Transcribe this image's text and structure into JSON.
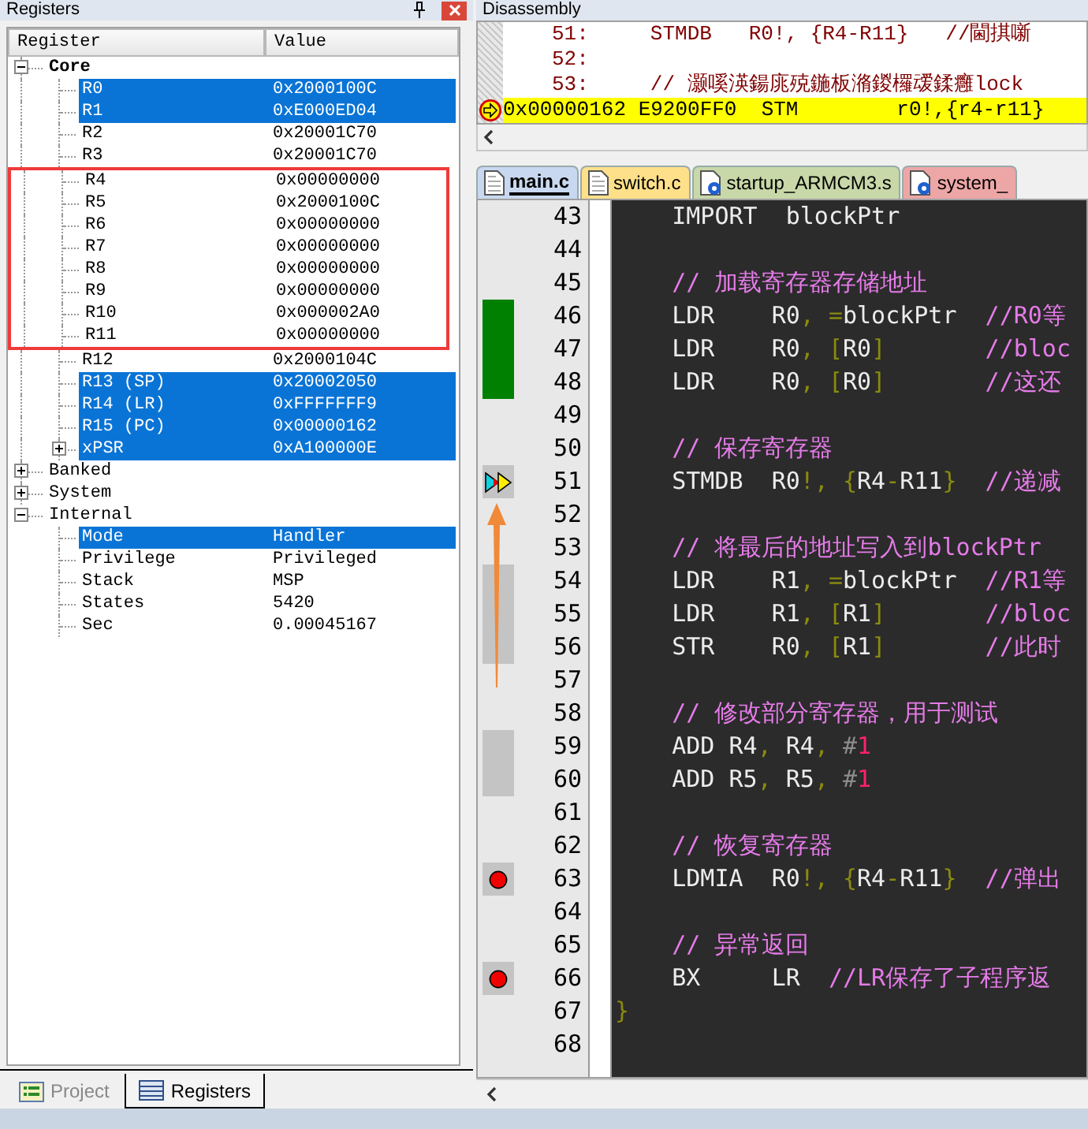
{
  "registers": {
    "title": "Registers",
    "columns": [
      "Register",
      "Value"
    ],
    "tree": [
      {
        "name": "Core",
        "bold": true,
        "expanded": true,
        "children": [
          {
            "name": "R0",
            "value": "0x2000100C",
            "selected": true,
            "boxed": false
          },
          {
            "name": "R1",
            "value": "0xE000ED04",
            "selected": true,
            "boxed": false
          },
          {
            "name": "R2",
            "value": "0x20001C70",
            "selected": false,
            "boxed": false
          },
          {
            "name": "R3",
            "value": "0x20001C70",
            "selected": false,
            "boxed": false
          },
          {
            "name": "R4",
            "value": "0x00000000",
            "selected": false,
            "boxed": true
          },
          {
            "name": "R5",
            "value": "0x2000100C",
            "selected": false,
            "boxed": true
          },
          {
            "name": "R6",
            "value": "0x00000000",
            "selected": false,
            "boxed": true
          },
          {
            "name": "R7",
            "value": "0x00000000",
            "selected": false,
            "boxed": true
          },
          {
            "name": "R8",
            "value": "0x00000000",
            "selected": false,
            "boxed": true
          },
          {
            "name": "R9",
            "value": "0x00000000",
            "selected": false,
            "boxed": true
          },
          {
            "name": "R10",
            "value": "0x000002A0",
            "selected": false,
            "boxed": true
          },
          {
            "name": "R11",
            "value": "0x00000000",
            "selected": false,
            "boxed": true
          },
          {
            "name": "R12",
            "value": "0x2000104C",
            "selected": false,
            "boxed": false
          },
          {
            "name": "R13 (SP)",
            "value": "0x20002050",
            "selected": true,
            "boxed": false
          },
          {
            "name": "R14 (LR)",
            "value": "0xFFFFFFF9",
            "selected": true,
            "boxed": false
          },
          {
            "name": "R15 (PC)",
            "value": "0x00000162",
            "selected": true,
            "boxed": false
          },
          {
            "name": "xPSR",
            "value": "0xA100000E",
            "selected": true,
            "boxed": false,
            "expanded": false
          }
        ]
      },
      {
        "name": "Banked",
        "bold": false,
        "expanded": false
      },
      {
        "name": "System",
        "bold": false,
        "expanded": false
      },
      {
        "name": "Internal",
        "bold": false,
        "expanded": true,
        "children": [
          {
            "name": "Mode",
            "value": "Handler",
            "selected": true,
            "boxed": false
          },
          {
            "name": "Privilege",
            "value": "Privileged",
            "selected": false,
            "boxed": false
          },
          {
            "name": "Stack",
            "value": "MSP",
            "selected": false,
            "boxed": false
          },
          {
            "name": "States",
            "value": "5420",
            "selected": false,
            "boxed": false
          },
          {
            "name": "Sec",
            "value": "0.00045167",
            "selected": false,
            "boxed": false
          }
        ]
      }
    ],
    "tabs": [
      {
        "label": "Project",
        "kind": "project",
        "selected": false
      },
      {
        "label": "Registers",
        "kind": "registers",
        "selected": true
      }
    ]
  },
  "disassembly": {
    "title": "Disassembly",
    "lines": [
      {
        "kind": "source",
        "text": "51:     STMDB   R0!, {R4-R11}   //閫掑噺"
      },
      {
        "kind": "source",
        "text": "52:"
      },
      {
        "kind": "source",
        "text": "53:     // 灏嗘渶鍚庣殑鍦板潃鍐欏叆鍒癰lock"
      },
      {
        "kind": "current",
        "text": "0x00000162 E9200FF0  STM        r0!,{r4-r11}"
      }
    ]
  },
  "editor": {
    "tabs": [
      {
        "label": "main.c",
        "kind": "source",
        "color": "#c8d8f0",
        "selected": true
      },
      {
        "label": "switch.c",
        "kind": "source",
        "color": "#ffe08a",
        "selected": false
      },
      {
        "label": "startup_ARMCM3.s",
        "kind": "library",
        "color": "#c8d8a8",
        "selected": false
      },
      {
        "label": "system_",
        "kind": "library",
        "color": "#eda6a6",
        "selected": false
      }
    ],
    "lines": [
      {
        "number": "43",
        "kind": "plain",
        "tokens": [
          {
            "text": "    IMPORT  blockPtr",
            "kind": "text"
          }
        ]
      },
      {
        "number": "44",
        "kind": "plain"
      },
      {
        "number": "45",
        "kind": "plain",
        "tokens": [
          {
            "text": "    // 加载寄存器存储地址",
            "kind": "comment"
          }
        ]
      },
      {
        "number": "46",
        "kind": "executed",
        "tokens": [
          {
            "text": "    LDR    R0",
            "kind": "text"
          },
          {
            "text": ", =",
            "kind": "punct"
          },
          {
            "text": "blockPtr",
            "kind": "text"
          },
          {
            "text": "  //R0等",
            "kind": "comment"
          }
        ]
      },
      {
        "number": "47",
        "kind": "executed",
        "tokens": [
          {
            "text": "    LDR    R0",
            "kind": "text"
          },
          {
            "text": ", [",
            "kind": "punct"
          },
          {
            "text": "R0",
            "kind": "text"
          },
          {
            "text": "]",
            "kind": "punct"
          },
          {
            "text": "       //bloc",
            "kind": "comment"
          }
        ]
      },
      {
        "number": "48",
        "kind": "executed",
        "tokens": [
          {
            "text": "    LDR    R0",
            "kind": "text"
          },
          {
            "text": ", [",
            "kind": "punct"
          },
          {
            "text": "R0",
            "kind": "text"
          },
          {
            "text": "]",
            "kind": "punct"
          },
          {
            "text": "       //这还",
            "kind": "comment"
          }
        ]
      },
      {
        "number": "49",
        "kind": "plain"
      },
      {
        "number": "50",
        "kind": "plain",
        "tokens": [
          {
            "text": "    // 保存寄存器",
            "kind": "comment"
          }
        ]
      },
      {
        "number": "51",
        "kind": "current",
        "tokens": [
          {
            "text": "    STMDB  R0",
            "kind": "text"
          },
          {
            "text": "!, {",
            "kind": "punct"
          },
          {
            "text": "R4",
            "kind": "text"
          },
          {
            "text": "-",
            "kind": "punct"
          },
          {
            "text": "R11",
            "kind": "text"
          },
          {
            "text": "}",
            "kind": "punct"
          },
          {
            "text": "  //递减",
            "kind": "comment"
          }
        ]
      },
      {
        "number": "52",
        "kind": "plain",
        "arrow_end": true
      },
      {
        "number": "53",
        "kind": "plain",
        "tokens": [
          {
            "text": "    // 将最后的地址写入到blockPtr",
            "kind": "comment"
          }
        ]
      },
      {
        "number": "54",
        "kind": "partial",
        "tokens": [
          {
            "text": "    LDR    R1",
            "kind": "text"
          },
          {
            "text": ", =",
            "kind": "punct"
          },
          {
            "text": "blockPtr",
            "kind": "text"
          },
          {
            "text": "  //R1等",
            "kind": "comment"
          }
        ]
      },
      {
        "number": "55",
        "kind": "partial",
        "tokens": [
          {
            "text": "    LDR    R1",
            "kind": "text"
          },
          {
            "text": ", [",
            "kind": "punct"
          },
          {
            "text": "R1",
            "kind": "text"
          },
          {
            "text": "]",
            "kind": "punct"
          },
          {
            "text": "       //bloc",
            "kind": "comment"
          }
        ]
      },
      {
        "number": "56",
        "kind": "partial",
        "tokens": [
          {
            "text": "    STR    R0",
            "kind": "text"
          },
          {
            "text": ", [",
            "kind": "punct"
          },
          {
            "text": "R1",
            "kind": "text"
          },
          {
            "text": "]",
            "kind": "punct"
          },
          {
            "text": "       //此时",
            "kind": "comment"
          }
        ]
      },
      {
        "number": "57",
        "kind": "plain",
        "arrow_start": true
      },
      {
        "number": "58",
        "kind": "plain",
        "tokens": [
          {
            "text": "    // 修改部分寄存器，用于测试",
            "kind": "comment"
          }
        ]
      },
      {
        "number": "59",
        "kind": "partial",
        "tokens": [
          {
            "text": "    ADD R4",
            "kind": "text"
          },
          {
            "text": ", ",
            "kind": "punct"
          },
          {
            "text": "R4",
            "kind": "text"
          },
          {
            "text": ", ",
            "kind": "punct"
          },
          {
            "text": "#",
            "kind": "hash"
          },
          {
            "text": "1",
            "kind": "number"
          }
        ]
      },
      {
        "number": "60",
        "kind": "partial",
        "tokens": [
          {
            "text": "    ADD R5",
            "kind": "text"
          },
          {
            "text": ", ",
            "kind": "punct"
          },
          {
            "text": "R5",
            "kind": "text"
          },
          {
            "text": ", ",
            "kind": "punct"
          },
          {
            "text": "#",
            "kind": "hash"
          },
          {
            "text": "1",
            "kind": "number"
          }
        ]
      },
      {
        "number": "61",
        "kind": "plain"
      },
      {
        "number": "62",
        "kind": "plain",
        "tokens": [
          {
            "text": "    // 恢复寄存器",
            "kind": "comment"
          }
        ]
      },
      {
        "number": "63",
        "kind": "breakpoint",
        "tokens": [
          {
            "text": "    LDMIA  R0",
            "kind": "text"
          },
          {
            "text": "!, {",
            "kind": "punct"
          },
          {
            "text": "R4",
            "kind": "text"
          },
          {
            "text": "-",
            "kind": "punct"
          },
          {
            "text": "R11",
            "kind": "text"
          },
          {
            "text": "}",
            "kind": "punct"
          },
          {
            "text": "  //弹出",
            "kind": "comment"
          }
        ]
      },
      {
        "number": "64",
        "kind": "plain"
      },
      {
        "number": "65",
        "kind": "plain",
        "tokens": [
          {
            "text": "    // 异常返回",
            "kind": "comment"
          }
        ]
      },
      {
        "number": "66",
        "kind": "breakpoint",
        "tokens": [
          {
            "text": "    BX     LR  ",
            "kind": "text"
          },
          {
            "text": "//LR保存了子程序返",
            "kind": "comment"
          }
        ]
      },
      {
        "number": "67",
        "kind": "plain",
        "tokens": [
          {
            "text": "}",
            "kind": "punct"
          }
        ]
      },
      {
        "number": "68",
        "kind": "plain"
      }
    ]
  }
}
